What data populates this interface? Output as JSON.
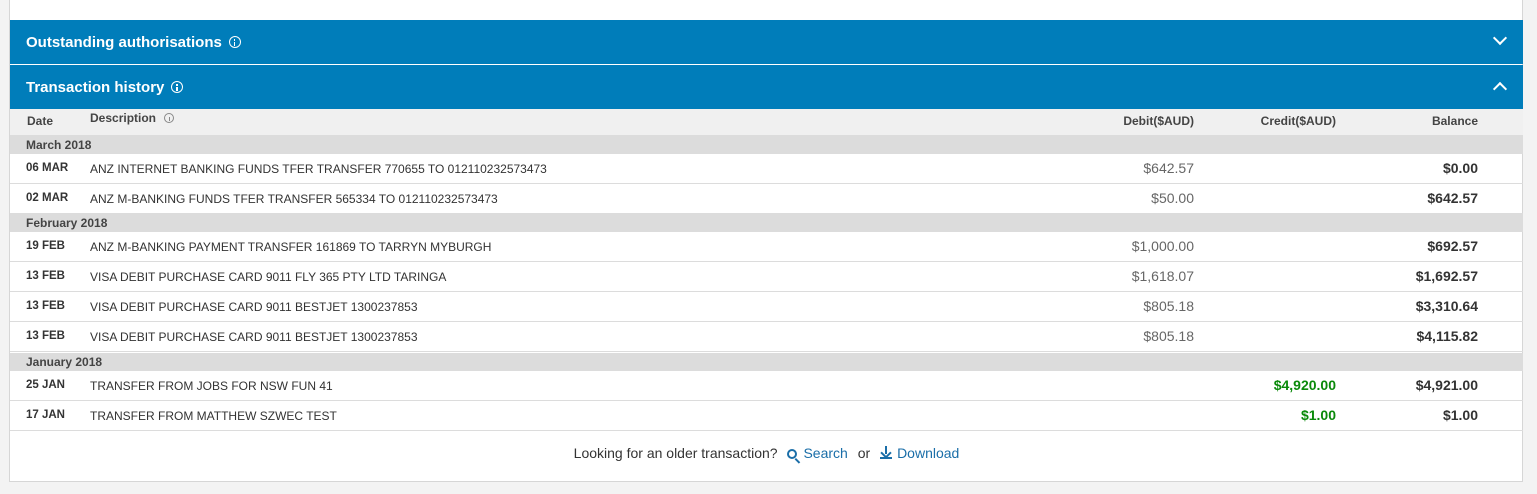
{
  "panels": {
    "outstanding": "Outstanding authorisations",
    "history": "Transaction history"
  },
  "table": {
    "headers": {
      "date": "Date",
      "description": "Description",
      "debit": "Debit($AUD)",
      "credit": "Credit($AUD)",
      "balance": "Balance"
    },
    "months": [
      "March  2018",
      "February  2018",
      "January  2018"
    ],
    "rows": [
      {
        "date": "06 MAR",
        "desc": "ANZ INTERNET BANKING FUNDS TFER TRANSFER 770655 TO 012110232573473",
        "debit": "$642.57",
        "credit": "",
        "balance": "$0.00"
      },
      {
        "date": "02 MAR",
        "desc": "ANZ M-BANKING FUNDS TFER TRANSFER 565334 TO 012110232573473",
        "debit": "$50.00",
        "credit": "",
        "balance": "$642.57"
      },
      {
        "date": "19 FEB",
        "desc": "ANZ M-BANKING PAYMENT TRANSFER 161869 TO TARRYN MYBURGH",
        "debit": "$1,000.00",
        "credit": "",
        "balance": "$692.57"
      },
      {
        "date": "13 FEB",
        "desc": "VISA DEBIT PURCHASE CARD 9011 FLY 365 PTY LTD TARINGA",
        "debit": "$1,618.07",
        "credit": "",
        "balance": "$1,692.57"
      },
      {
        "date": "13 FEB",
        "desc": "VISA DEBIT PURCHASE CARD 9011 BESTJET 1300237853",
        "debit": "$805.18",
        "credit": "",
        "balance": "$3,310.64"
      },
      {
        "date": "13 FEB",
        "desc": "VISA DEBIT PURCHASE CARD 9011 BESTJET 1300237853",
        "debit": "$805.18",
        "credit": "",
        "balance": "$4,115.82"
      },
      {
        "date": "25 JAN",
        "desc": "TRANSFER FROM JOBS FOR NSW FUN 41",
        "debit": "",
        "credit": "$4,920.00",
        "balance": "$4,921.00"
      },
      {
        "date": "17 JAN",
        "desc": "TRANSFER FROM MATTHEW SZWEC TEST",
        "debit": "",
        "credit": "$1.00",
        "balance": "$1.00"
      }
    ]
  },
  "footer": {
    "prompt": "Looking for an older transaction?",
    "search": "Search",
    "or": "or",
    "download": "Download"
  },
  "colors": {
    "header_blue": "#007dba",
    "credit_green": "#0a8a0a",
    "link_blue": "#1a6ea8"
  }
}
